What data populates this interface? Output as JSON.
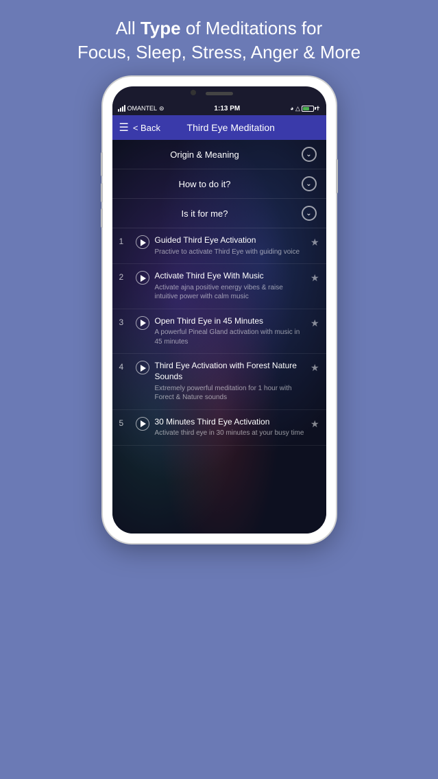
{
  "headline": {
    "prefix": "All ",
    "bold": "Type",
    "suffix": " of Meditations for\nFocus, Sleep, Stress, Anger & More"
  },
  "statusBar": {
    "carrier": "OMANTEL",
    "time": "1:13 PM",
    "icons_right": "⊙ ⏰"
  },
  "navBar": {
    "hamburger": "☰",
    "backLabel": "< Back",
    "title": "Third Eye Meditation"
  },
  "accordion": {
    "items": [
      {
        "label": "Origin & Meaning",
        "id": "origin"
      },
      {
        "label": "How to do it?",
        "id": "how"
      },
      {
        "label": "Is it for me?",
        "id": "isit"
      }
    ]
  },
  "tracks": [
    {
      "number": "1",
      "title": "Guided Third Eye Activation",
      "description": "Practive to activate Third Eye with guiding voice"
    },
    {
      "number": "2",
      "title": "Activate Third Eye With Music",
      "description": "Activate ajna positive energy vibes & raise intuitive power with calm music"
    },
    {
      "number": "3",
      "title": "Open Third Eye in 45 Minutes",
      "description": "A powerful Pineal Gland activation with music in 45 minutes"
    },
    {
      "number": "4",
      "title": "Third Eye Activation with Forest Nature Sounds",
      "description": "Extremely powerful meditation for 1 hour with Forect & Nature sounds"
    },
    {
      "number": "5",
      "title": "30 Minutes Third Eye Activation",
      "description": "Activate third eye in 30 minutes at your busy time"
    }
  ]
}
